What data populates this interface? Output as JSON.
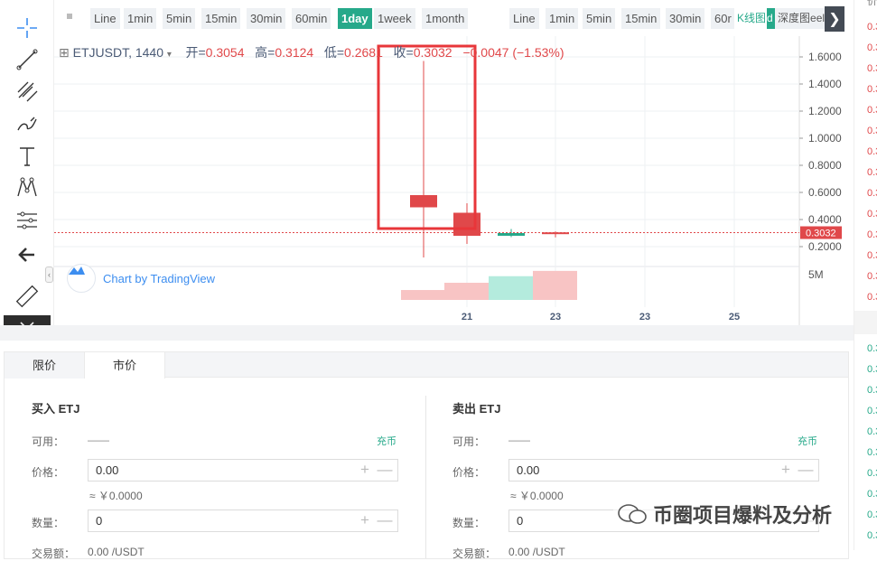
{
  "toolbar": {
    "tools": [
      "crosshair-icon",
      "trend-line-icon",
      "fib-icon",
      "brush-icon",
      "text-icon",
      "pattern-icon",
      "measure-icon",
      "back-arrow-icon",
      "ruler-icon",
      "magnet-icon"
    ]
  },
  "intervals": {
    "left": [
      "Line",
      "1min",
      "5min",
      "15min",
      "30min",
      "60min",
      "1day",
      "1week",
      "1month"
    ],
    "active": "1day",
    "right": [
      "Line",
      "1min",
      "5min",
      "15min",
      "30min",
      "60r"
    ],
    "kline_tab": "K线图",
    "depth_mark": "d",
    "depth_tab": "深度图",
    "depth_overflow": "eel",
    "next": "❯"
  },
  "legend": {
    "symbol_icon": "⊞",
    "pair": "ETJUSDT, 1440",
    "caret": "▾",
    "open_label": "开=",
    "open": "0.3054",
    "high_label": "高=",
    "high": "0.3124",
    "low_label": "低=",
    "low": "0.2681",
    "close_label": "收=",
    "close": "0.3032",
    "change": "−0.0047 (−1.53%)"
  },
  "tradingview": {
    "label": "Chart by TradingView"
  },
  "colors": {
    "up": "#26a98a",
    "down": "#e0484a",
    "accent": "#3d8ef0",
    "highlight_box": "#e8363a"
  },
  "chart_data": {
    "type": "candlestick",
    "y_ticks": [
      "1.6000",
      "1.4000",
      "1.2000",
      "1.0000",
      "0.8000",
      "0.6000",
      "0.4000",
      "0.2000"
    ],
    "last_price": "0.3032",
    "volume_tick": "5M",
    "x_ticks": [
      "21",
      "23",
      "23",
      "25"
    ],
    "candles": [
      {
        "open": 0.58,
        "close": 0.49,
        "high": 1.57,
        "low": 0.12,
        "dir": "down"
      },
      {
        "open": 0.45,
        "close": 0.28,
        "high": 0.52,
        "low": 0.22,
        "dir": "down"
      },
      {
        "open": 0.28,
        "close": 0.3,
        "high": 0.33,
        "low": 0.27,
        "dir": "up"
      },
      {
        "open": 0.3054,
        "close": 0.3032,
        "high": 0.3124,
        "low": 0.2681,
        "dir": "down"
      }
    ],
    "volumes_m": [
      1.5,
      2.6,
      3.6,
      4.4
    ],
    "volume_dirs": [
      "down",
      "down",
      "up",
      "down"
    ]
  },
  "orderbook": {
    "header": "价",
    "sells": [
      "0.3",
      "0.3",
      "0.3",
      "0.3",
      "0.3",
      "0.3",
      "0.3",
      "0.3",
      "0.3",
      "0.3",
      "0.3",
      "0.3",
      "0.3",
      "0.3"
    ],
    "buys": [
      "0.3",
      "0.3",
      "0.3",
      "0.3",
      "0.3",
      "0.3",
      "0.3",
      "0.3",
      "0.3",
      "0.3"
    ]
  },
  "trade": {
    "tab_limit": "限价",
    "tab_market": "市价",
    "buy": {
      "title": "买入 ETJ",
      "available_label": "可用：",
      "available_value": "——",
      "charge": "充币",
      "price_label": "价格：",
      "price_value": "0.00",
      "approx": "≈ ￥0.0000",
      "qty_label": "数量：",
      "qty_value": "0",
      "amount_label": "交易额：",
      "amount_value": "0.00 /USDT"
    },
    "sell": {
      "title": "卖出 ETJ",
      "available_label": "可用：",
      "available_value": "——",
      "charge": "充币",
      "price_label": "价格：",
      "price_value": "0.00",
      "approx": "≈ ￥0.0000",
      "qty_label": "数量：",
      "qty_value": "0",
      "amount_label": "交易额：",
      "amount_value": "0.00 /USDT"
    },
    "plus": "+",
    "minus": "—"
  },
  "watermark": {
    "text": "币圈项目爆料及分析"
  }
}
